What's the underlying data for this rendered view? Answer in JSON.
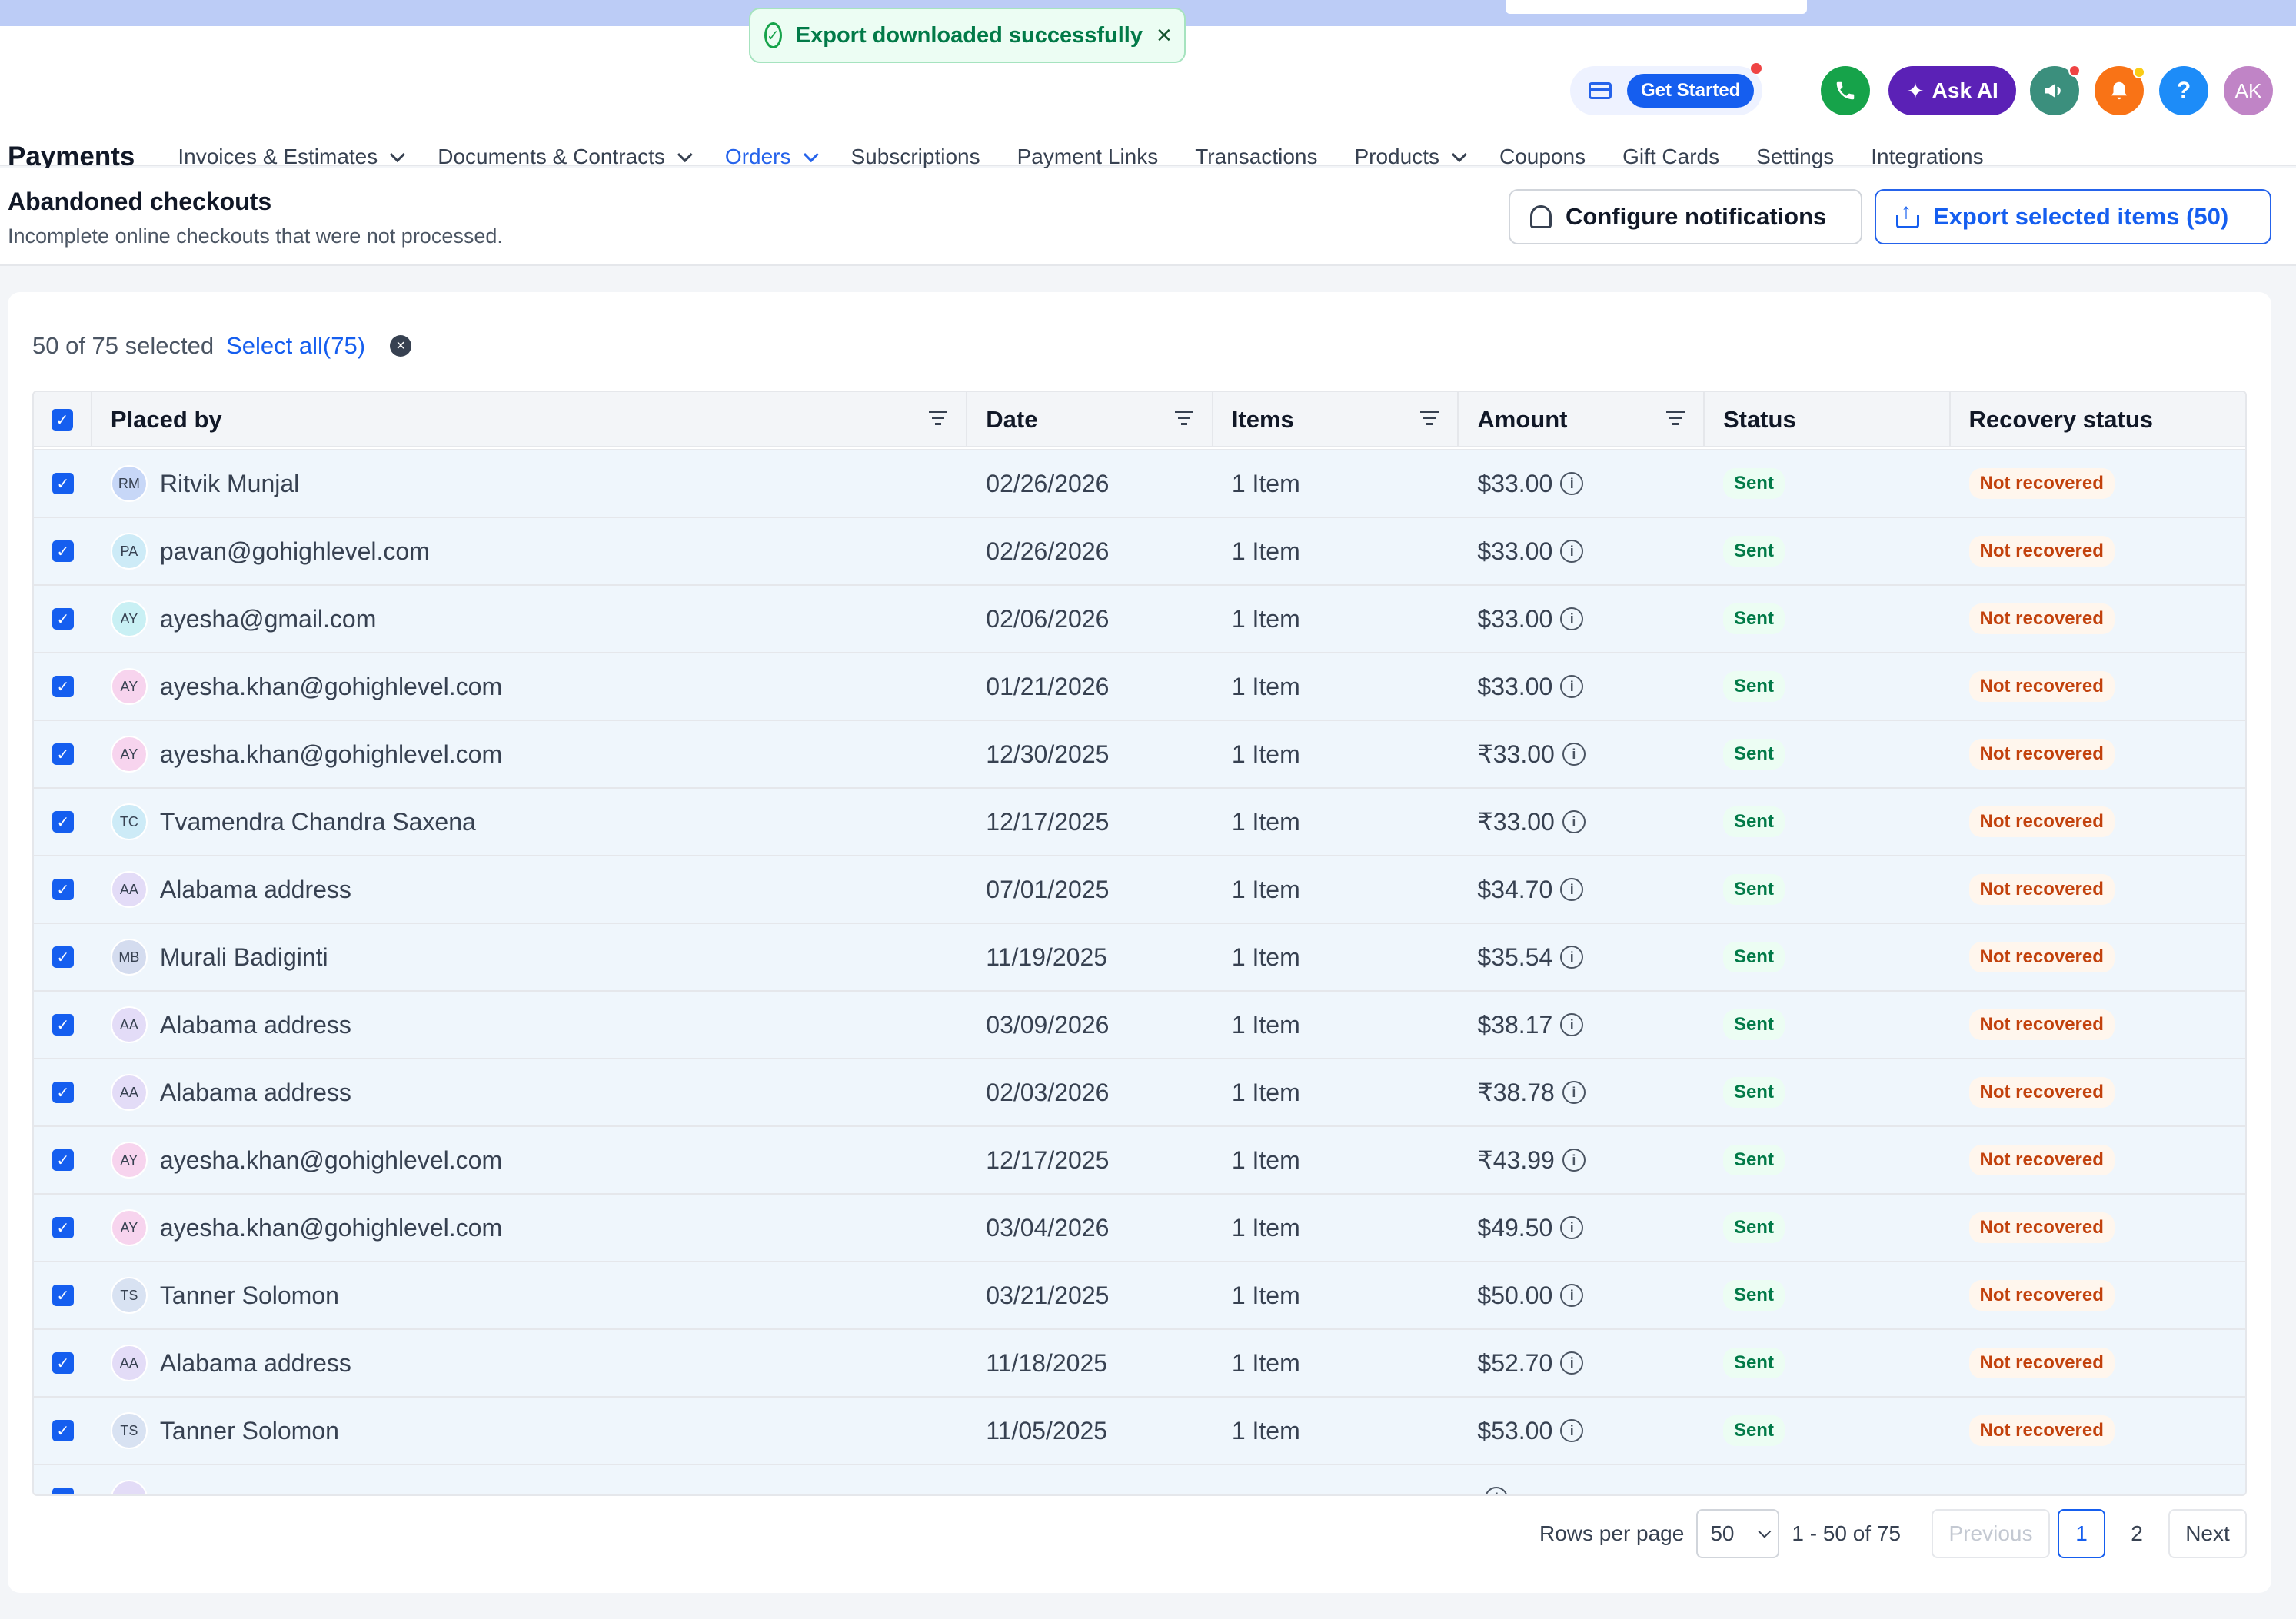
{
  "toast": {
    "message": "Export downloaded successfully",
    "icon": "check-circle-icon"
  },
  "topbar": {
    "get_started": "Get Started",
    "ask_ai": "Ask AI",
    "avatar_initials": "AK",
    "help": "?"
  },
  "nav": {
    "brand": "Payments",
    "items": [
      {
        "label": "Invoices & Estimates",
        "dropdown": true
      },
      {
        "label": "Documents & Contracts",
        "dropdown": true
      },
      {
        "label": "Orders",
        "dropdown": true,
        "active": true
      },
      {
        "label": "Subscriptions"
      },
      {
        "label": "Payment Links"
      },
      {
        "label": "Transactions"
      },
      {
        "label": "Products",
        "dropdown": true
      },
      {
        "label": "Coupons"
      },
      {
        "label": "Gift Cards"
      },
      {
        "label": "Settings"
      },
      {
        "label": "Integrations"
      }
    ]
  },
  "page": {
    "title": "Abandoned checkouts",
    "description": "Incomplete online checkouts that were not processed.",
    "configure_label": "Configure notifications",
    "export_label": "Export selected items (50)"
  },
  "selection": {
    "count_text": "50 of 75 selected",
    "select_all": "Select all(75)"
  },
  "table": {
    "columns": [
      "Placed by",
      "Date",
      "Items",
      "Amount",
      "Status",
      "Recovery status"
    ],
    "rows": [
      {
        "initials": "RM",
        "name": "Ritvik Munjal",
        "date": "02/26/2026",
        "items": "1 Item",
        "amount": "$33.00",
        "status": "Sent",
        "recovery": "Not recovered",
        "avatar_color": "#c7d7f7"
      },
      {
        "initials": "PA",
        "name": "pavan@gohighlevel.com",
        "date": "02/26/2026",
        "items": "1 Item",
        "amount": "$33.00",
        "status": "Sent",
        "recovery": "Not recovered",
        "avatar_color": "#cdebf7"
      },
      {
        "initials": "AY",
        "name": "ayesha@gmail.com",
        "date": "02/06/2026",
        "items": "1 Item",
        "amount": "$33.00",
        "status": "Sent",
        "recovery": "Not recovered",
        "avatar_color": "#c9f0f4"
      },
      {
        "initials": "AY",
        "name": "ayesha.khan@gohighlevel.com",
        "date": "01/21/2026",
        "items": "1 Item",
        "amount": "$33.00",
        "status": "Sent",
        "recovery": "Not recovered",
        "avatar_color": "#f7d4ee"
      },
      {
        "initials": "AY",
        "name": "ayesha.khan@gohighlevel.com",
        "date": "12/30/2025",
        "items": "1 Item",
        "amount": "₹33.00",
        "status": "Sent",
        "recovery": "Not recovered",
        "avatar_color": "#f7d4ee"
      },
      {
        "initials": "TC",
        "name": "Tvamendra Chandra Saxena",
        "date": "12/17/2025",
        "items": "1 Item",
        "amount": "₹33.00",
        "status": "Sent",
        "recovery": "Not recovered",
        "avatar_color": "#cdebf7"
      },
      {
        "initials": "AA",
        "name": "Alabama address",
        "date": "07/01/2025",
        "items": "1 Item",
        "amount": "$34.70",
        "status": "Sent",
        "recovery": "Not recovered",
        "avatar_color": "#e3dcf7"
      },
      {
        "initials": "MB",
        "name": "Murali Badiginti",
        "date": "11/19/2025",
        "items": "1 Item",
        "amount": "$35.54",
        "status": "Sent",
        "recovery": "Not recovered",
        "avatar_color": "#d4dcef"
      },
      {
        "initials": "AA",
        "name": "Alabama address",
        "date": "03/09/2026",
        "items": "1 Item",
        "amount": "$38.17",
        "status": "Sent",
        "recovery": "Not recovered",
        "avatar_color": "#e3dcf7"
      },
      {
        "initials": "AA",
        "name": "Alabama address",
        "date": "02/03/2026",
        "items": "1 Item",
        "amount": "₹38.78",
        "status": "Sent",
        "recovery": "Not recovered",
        "avatar_color": "#e3dcf7"
      },
      {
        "initials": "AY",
        "name": "ayesha.khan@gohighlevel.com",
        "date": "12/17/2025",
        "items": "1 Item",
        "amount": "₹43.99",
        "status": "Sent",
        "recovery": "Not recovered",
        "avatar_color": "#f7d4ee"
      },
      {
        "initials": "AY",
        "name": "ayesha.khan@gohighlevel.com",
        "date": "03/04/2026",
        "items": "1 Item",
        "amount": "$49.50",
        "status": "Sent",
        "recovery": "Not recovered",
        "avatar_color": "#f7d4ee"
      },
      {
        "initials": "TS",
        "name": "Tanner Solomon",
        "date": "03/21/2025",
        "items": "1 Item",
        "amount": "$50.00",
        "status": "Sent",
        "recovery": "Not recovered",
        "avatar_color": "#d8e2f2"
      },
      {
        "initials": "AA",
        "name": "Alabama address",
        "date": "11/18/2025",
        "items": "1 Item",
        "amount": "$52.70",
        "status": "Sent",
        "recovery": "Not recovered",
        "avatar_color": "#e3dcf7"
      },
      {
        "initials": "TS",
        "name": "Tanner Solomon",
        "date": "11/05/2025",
        "items": "1 Item",
        "amount": "$53.00",
        "status": "Sent",
        "recovery": "Not recovered",
        "avatar_color": "#d8e2f2"
      },
      {
        "initials": "",
        "name": "",
        "date": "",
        "items": "",
        "amount": "",
        "status": "",
        "recovery": "",
        "avatar_color": "#e3dcf7"
      }
    ]
  },
  "pagination": {
    "rows_per_page_label": "Rows per page",
    "rows_per_page_value": "50",
    "range": "1 - 50 of 75",
    "previous": "Previous",
    "page1": "1",
    "page2": "2",
    "next": "Next"
  },
  "colors": {
    "accent": "#155eef",
    "success": "#027a48",
    "warning": "#c2410c"
  }
}
